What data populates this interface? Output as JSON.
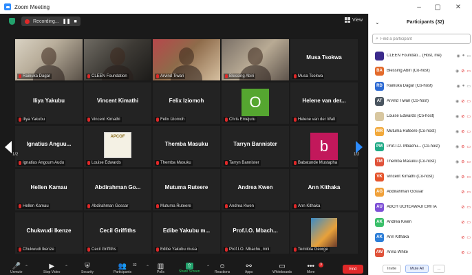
{
  "window": {
    "title": "Zoom Meeting",
    "minimize": "–",
    "maximize": "▢",
    "close": "✕"
  },
  "meeting_bar": {
    "recording_label": "Recording...",
    "pause_glyph": "❚❚",
    "stop_glyph": "■",
    "view_label": "View"
  },
  "pager": {
    "left": "1/2",
    "right": "1/2"
  },
  "tiles": [
    {
      "name": "Rainuka Dagar",
      "big": "",
      "kind": "video",
      "active": true
    },
    {
      "name": "CLEEN Foundation",
      "big": "",
      "kind": "video"
    },
    {
      "name": "Arvind Tiwari",
      "big": "",
      "kind": "video"
    },
    {
      "name": "Blessing Abiri",
      "big": "",
      "kind": "video"
    },
    {
      "name": "Musa Tsokwa",
      "big": "Musa Tsokwa",
      "kind": "name"
    },
    {
      "name": "Iliya Yakubu",
      "big": "Iliya Yakubu",
      "kind": "name"
    },
    {
      "name": "Vincent Kimathi",
      "big": "Vincent Kimathi",
      "kind": "name"
    },
    {
      "name": "Felix Iziomoh",
      "big": "Felix Iziomoh",
      "kind": "name"
    },
    {
      "name": "Chris Emejuru",
      "big": "",
      "kind": "avatar",
      "letter": "O"
    },
    {
      "name": "Helene van der Walt",
      "big": "Helene van der...",
      "kind": "name"
    },
    {
      "name": "Ignatius Angoum Audu",
      "big": "Ignatius Anguu...",
      "kind": "name"
    },
    {
      "name": "Louise Edwards",
      "big": "",
      "kind": "logo",
      "logo_text": "APCOF"
    },
    {
      "name": "Themba Masuku",
      "big": "Themba Masuku",
      "kind": "name"
    },
    {
      "name": "Tarryn Bannister",
      "big": "Tarryn Bannister",
      "kind": "name"
    },
    {
      "name": "Babatunde Mustapha",
      "big": "",
      "kind": "avatar",
      "letter": "b"
    },
    {
      "name": "Hellen Kamau",
      "big": "Hellen Kamau",
      "kind": "name"
    },
    {
      "name": "Abdirahman Gossar",
      "big": "Abdirahman Go...",
      "kind": "name"
    },
    {
      "name": "Mutuma Ruteere",
      "big": "Mutuma Ruteere",
      "kind": "name"
    },
    {
      "name": "Andrea Kwen",
      "big": "Andrea Kwen",
      "kind": "name"
    },
    {
      "name": "Ann Kithaka",
      "big": "Ann Kithaka",
      "kind": "name"
    },
    {
      "name": "Chukwudi Ikenze",
      "big": "Chukwudi Ikenze",
      "kind": "name"
    },
    {
      "name": "Cecil Griffiths",
      "big": "Cecil Griffiths",
      "kind": "name"
    },
    {
      "name": "Edibe Yakubu musa",
      "big": "Edibe Yakubu m...",
      "kind": "name"
    },
    {
      "name": "Prof.I.O. Mbachu, mni",
      "big": "Prof.I.O. Mbach...",
      "kind": "name"
    },
    {
      "name": "Temilola George",
      "big": "",
      "kind": "video"
    }
  ],
  "toolbar": {
    "participants_count": "32",
    "chat_badge": "3",
    "end_label": "End",
    "buttons": [
      {
        "label": "Unmute",
        "icon": "🎤"
      },
      {
        "label": "Stop Video",
        "icon": "▶"
      },
      {
        "label": "Security",
        "icon": "⛨"
      },
      {
        "label": "Participants",
        "icon": "👥"
      },
      {
        "label": "Polls",
        "icon": "▥"
      },
      {
        "label": "Share Screen",
        "icon": "⇧"
      },
      {
        "label": "Reactions",
        "icon": "☺"
      },
      {
        "label": "Apps",
        "icon": "⚯"
      },
      {
        "label": "Whiteboards",
        "icon": "▭"
      },
      {
        "label": "More",
        "icon": "•••"
      }
    ]
  },
  "panel": {
    "title": "Participants (32)",
    "search_placeholder": "Find a participant",
    "invite_label": "Invite",
    "mute_all_label": "Mute All",
    "more_label": "...",
    "participants": [
      {
        "initials": "",
        "name": "CLEEN Foundati... (Host, me)",
        "color": "#3b2a8c",
        "muted": false
      },
      {
        "initials": "BA",
        "name": "Blessing Abiri (Co-host)",
        "color": "#e36a2b",
        "muted": true
      },
      {
        "initials": "RD",
        "name": "Rainuka Dagar (Co-host)",
        "color": "#2d6ad3",
        "muted": false
      },
      {
        "initials": "AT",
        "name": "Arvind Tiwari (Co-host)",
        "color": "#4a5560",
        "muted": true
      },
      {
        "initials": "",
        "name": "Louise Edwards (Co-host)",
        "color": "#d8c7a0",
        "muted": true
      },
      {
        "initials": "MR",
        "name": "Mutuma Ruteere (Co-host)",
        "color": "#f2a93b",
        "muted": true
      },
      {
        "initials": "PM",
        "name": "Prof.I.O. Mbachu... (Co-host)",
        "color": "#1faa86",
        "muted": true
      },
      {
        "initials": "TM",
        "name": "Themba Masuku (Co-host)",
        "color": "#e0523a",
        "muted": true
      },
      {
        "initials": "VK",
        "name": "Vincent Kimathi (Co-host)",
        "color": "#e5542c",
        "muted": true
      },
      {
        "initials": "AG",
        "name": "Abdirahman Gossar",
        "color": "#f0a13b",
        "muted": true
      },
      {
        "initials": "AU",
        "name": "ABCH UCHEAWAJI EMITA",
        "color": "#7d4fd6",
        "muted": true
      },
      {
        "initials": "AK",
        "name": "Andrea Kwen",
        "color": "#3bbf6a",
        "muted": true
      },
      {
        "initials": "AK",
        "name": "Ann Kithaka",
        "color": "#2d7ed8",
        "muted": true
      },
      {
        "initials": "AW",
        "name": "Anna White",
        "color": "#e0523a",
        "muted": true
      }
    ]
  }
}
